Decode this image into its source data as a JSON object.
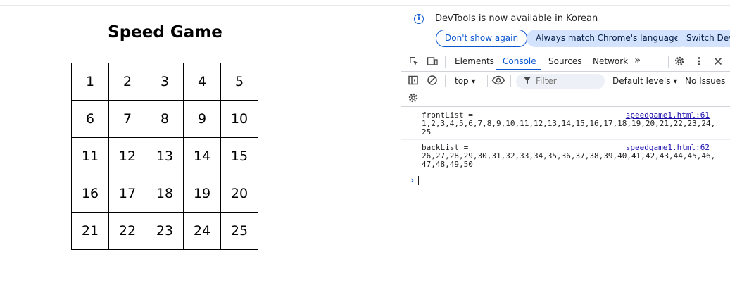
{
  "page": {
    "title": "Speed Game",
    "board": [
      [
        "1",
        "2",
        "3",
        "4",
        "5"
      ],
      [
        "6",
        "7",
        "8",
        "9",
        "10"
      ],
      [
        "11",
        "12",
        "13",
        "14",
        "15"
      ],
      [
        "16",
        "17",
        "18",
        "19",
        "20"
      ],
      [
        "21",
        "22",
        "23",
        "24",
        "25"
      ]
    ]
  },
  "devtools": {
    "infobar": {
      "text": "DevTools is now available in Korean",
      "dont_show": "Don't show again",
      "always_match": "Always match Chrome's language",
      "switch": "Switch DevT"
    },
    "tabs": [
      "Elements",
      "Console",
      "Sources",
      "Network"
    ],
    "more_tabs": "»",
    "console_toolbar": {
      "context": "top ▾",
      "filter_placeholder": "Filter",
      "levels": "Default levels ▾",
      "issues": "No Issues"
    },
    "messages": [
      {
        "label": "frontList =",
        "value": "1,2,3,4,5,6,7,8,9,10,11,12,13,14,15,16,17,18,19,20,21,22,23,24,25",
        "source": "speedgame1.html:61"
      },
      {
        "label": "backList =",
        "value": "26,27,28,29,30,31,32,33,34,35,36,37,38,39,40,41,42,43,44,45,46,47,48,49,50",
        "source": "speedgame1.html:62"
      }
    ],
    "prompt": "›"
  },
  "colors": {
    "accent": "#0b57d0",
    "chip": "#d3e3fd",
    "link": "#1a0dab"
  },
  "icons": [
    "info-icon",
    "inspect-element-icon",
    "device-toolbar-icon",
    "more-tabs-icon",
    "settings-gear-icon",
    "kebab-menu-icon",
    "close-icon",
    "sidebar-toggle-icon",
    "clear-console-icon",
    "eye-icon",
    "filter-icon",
    "console-settings-icon"
  ]
}
